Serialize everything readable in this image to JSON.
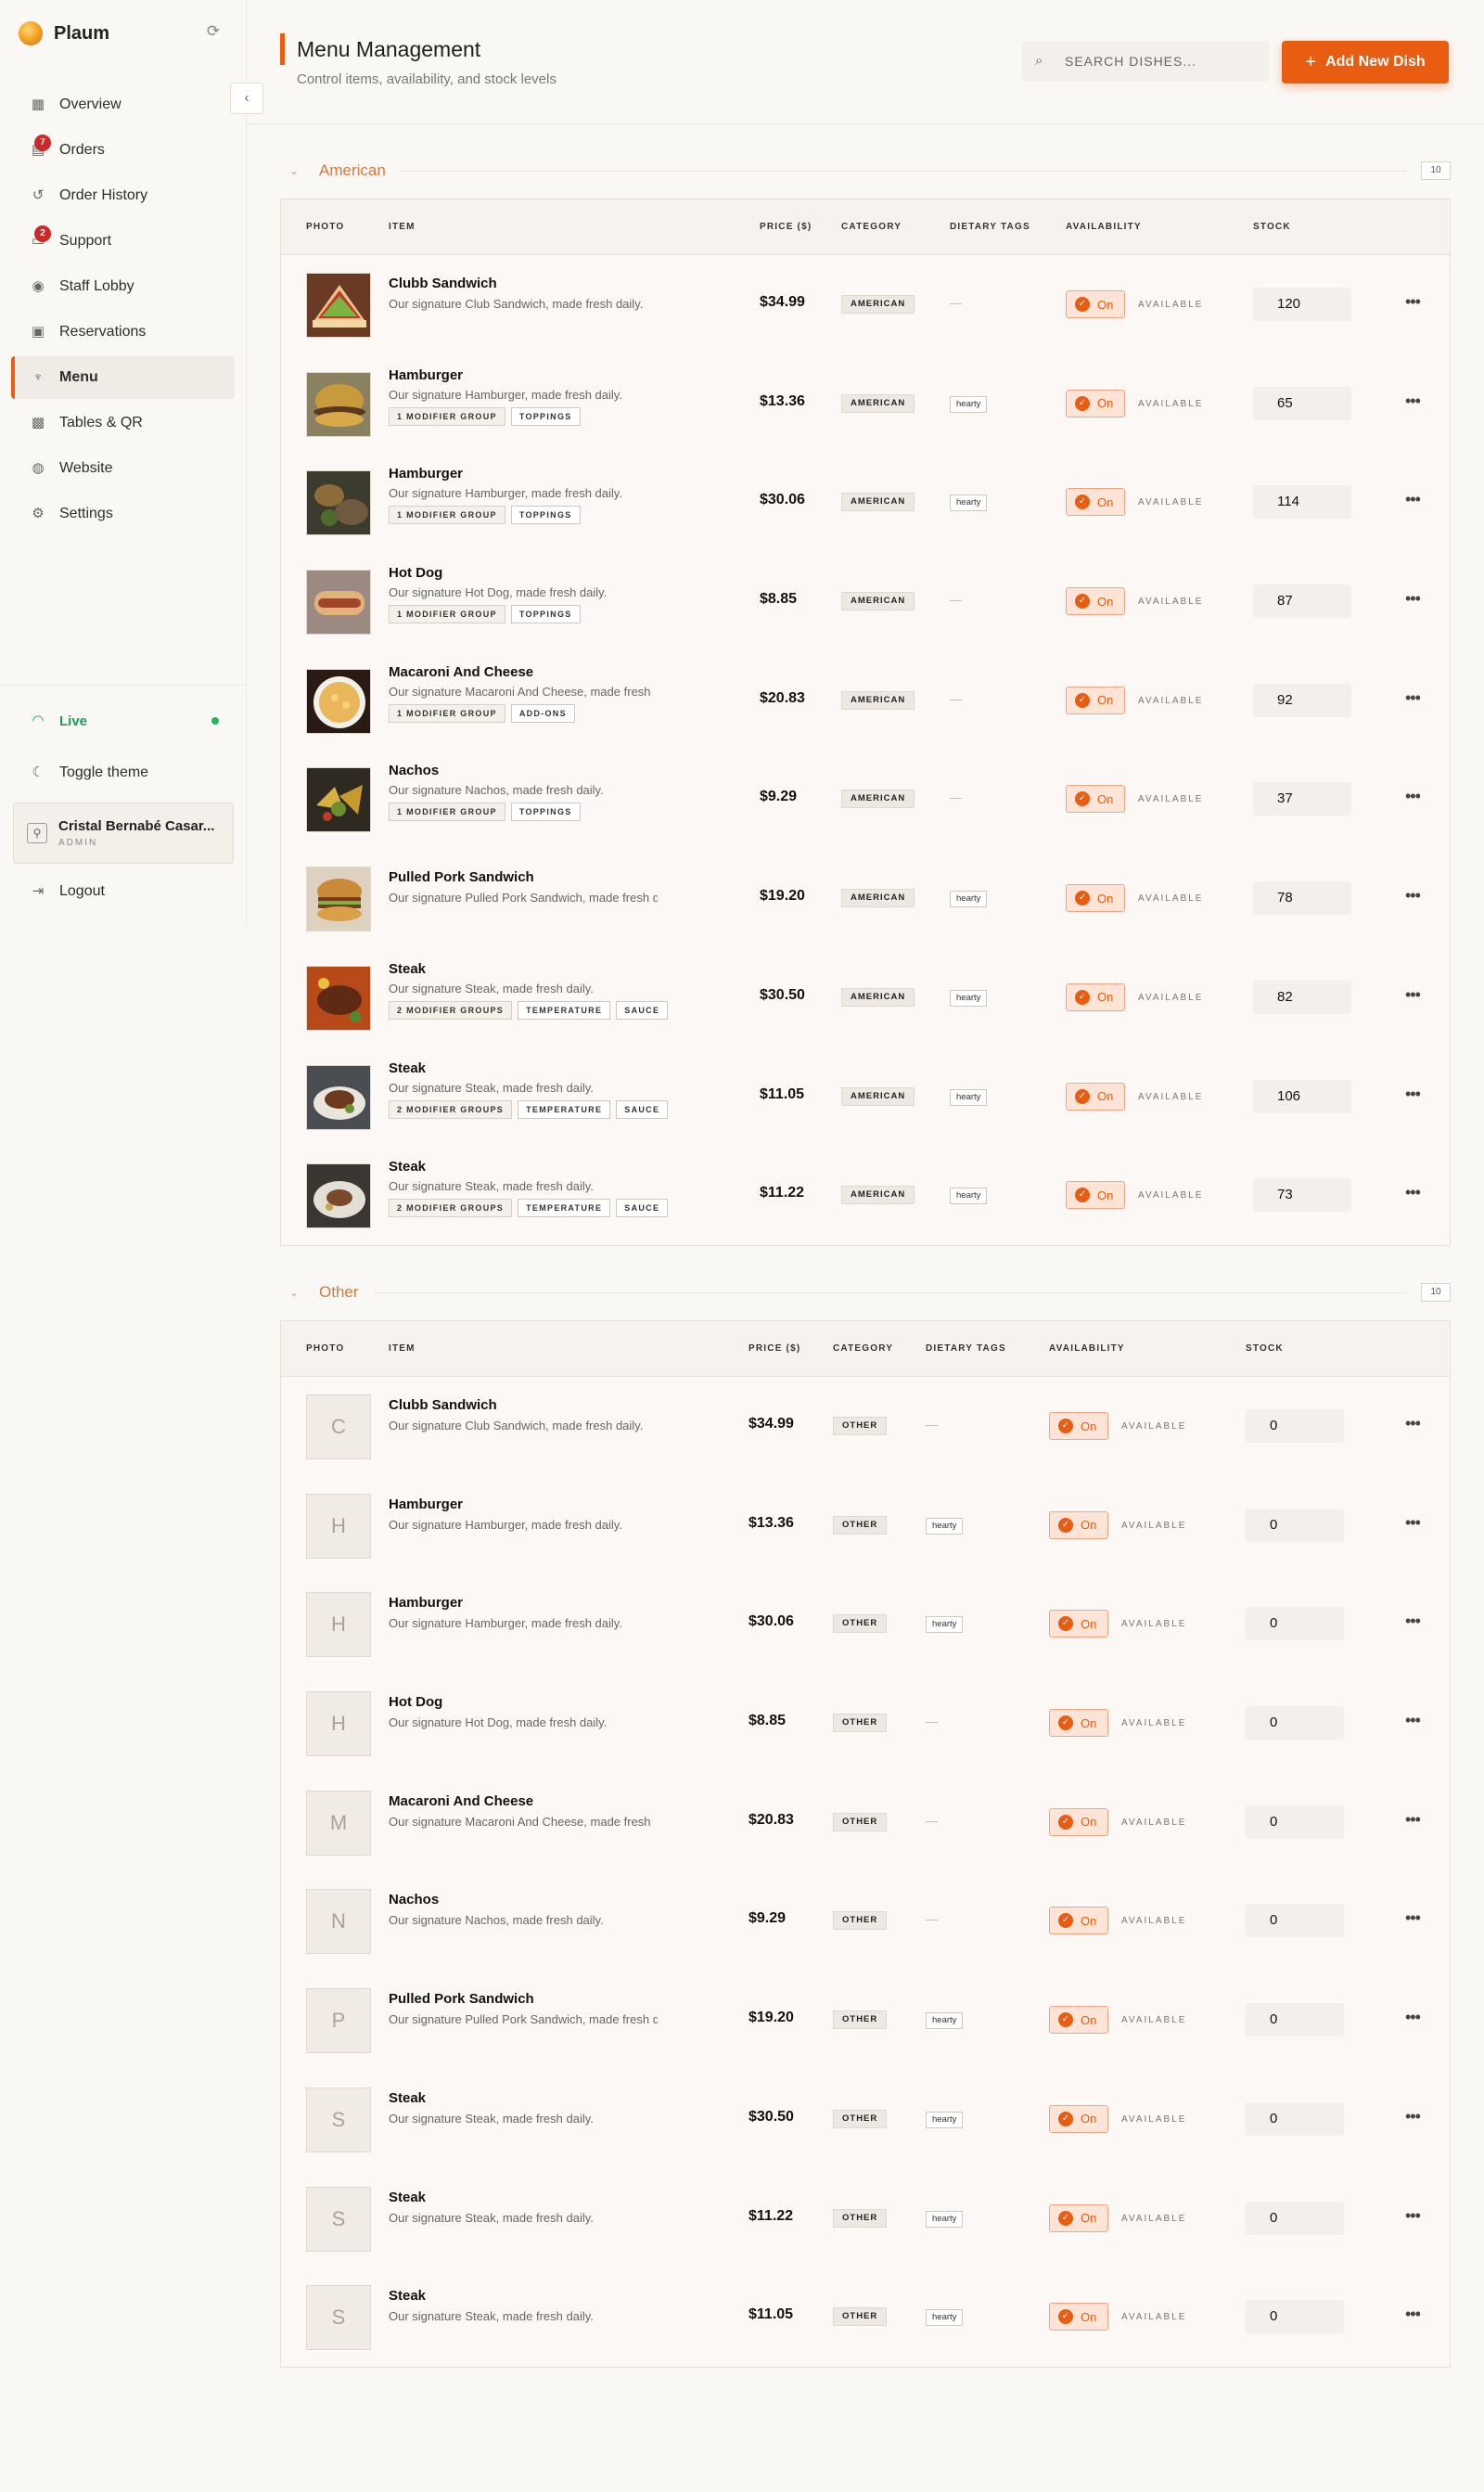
{
  "brand": {
    "name": "Plaum",
    "logo_icon": "logo-icon",
    "refresh_icon": "refresh-icon"
  },
  "nav": [
    {
      "label": "Overview",
      "icon": "grid-icon",
      "glyph": "▦",
      "badge": null,
      "active": false
    },
    {
      "label": "Orders",
      "icon": "receipt-icon",
      "glyph": "▤",
      "badge": "7",
      "active": false
    },
    {
      "label": "Order History",
      "icon": "history-icon",
      "glyph": "↺",
      "badge": null,
      "active": false
    },
    {
      "label": "Support",
      "icon": "chat-icon",
      "glyph": "▭",
      "badge": "2",
      "active": false
    },
    {
      "label": "Staff Lobby",
      "icon": "broadcast-icon",
      "glyph": "◉",
      "badge": null,
      "active": false
    },
    {
      "label": "Reservations",
      "icon": "calendar-icon",
      "glyph": "▣",
      "badge": null,
      "active": false
    },
    {
      "label": "Menu",
      "icon": "utensils-icon",
      "glyph": "♆",
      "badge": null,
      "active": true
    },
    {
      "label": "Tables & QR",
      "icon": "qr-icon",
      "glyph": "▩",
      "badge": null,
      "active": false
    },
    {
      "label": "Website",
      "icon": "globe-icon",
      "glyph": "◍",
      "badge": null,
      "active": false
    },
    {
      "label": "Settings",
      "icon": "gear-icon",
      "glyph": "⚙",
      "badge": null,
      "active": false
    }
  ],
  "sidebar_footer": {
    "live": "Live",
    "toggle_theme": "Toggle theme",
    "user_name": "Cristal Bernabé Casar...",
    "user_role": "ADMIN",
    "logout": "Logout"
  },
  "header": {
    "title": "Menu Management",
    "subtitle": "Control items, availability, and stock levels",
    "search_placeholder": "SEARCH DISHES...",
    "add_button": "Add New Dish"
  },
  "columns": {
    "photo": "PHOTO",
    "item": "ITEM",
    "price": "PRICE ($)",
    "category": "CATEGORY",
    "dietary": "DIETARY TAGS",
    "availability": "AVAILABILITY",
    "stock": "STOCK"
  },
  "colors": {
    "accent": "#e85d12",
    "live": "#22b565",
    "badge": "#c92a2a",
    "section": "#d8783c"
  },
  "sections": [
    {
      "title": "American",
      "count": "10",
      "has_photos": true,
      "items": [
        {
          "name": "Clubb Sandwich",
          "desc": "Our signature Club Sandwich, made fresh daily.",
          "tags": [],
          "price": "$34.99",
          "category": "AMERICAN",
          "diet": "",
          "toggle": "On",
          "availability": "AVAILABLE",
          "stock": "120",
          "initial": "C"
        },
        {
          "name": "Hamburger",
          "desc": "Our signature Hamburger, made fresh daily.",
          "tags": [
            "1 MODIFIER GROUP",
            "TOPPINGS"
          ],
          "price": "$13.36",
          "category": "AMERICAN",
          "diet": "hearty",
          "toggle": "On",
          "availability": "AVAILABLE",
          "stock": "65",
          "initial": "H"
        },
        {
          "name": "Hamburger",
          "desc": "Our signature Hamburger, made fresh daily.",
          "tags": [
            "1 MODIFIER GROUP",
            "TOPPINGS"
          ],
          "price": "$30.06",
          "category": "AMERICAN",
          "diet": "hearty",
          "toggle": "On",
          "availability": "AVAILABLE",
          "stock": "114",
          "initial": "H"
        },
        {
          "name": "Hot Dog",
          "desc": "Our signature Hot Dog, made fresh daily.",
          "tags": [
            "1 MODIFIER GROUP",
            "TOPPINGS"
          ],
          "price": "$8.85",
          "category": "AMERICAN",
          "diet": "",
          "toggle": "On",
          "availability": "AVAILABLE",
          "stock": "87",
          "initial": "H"
        },
        {
          "name": "Macaroni And Cheese",
          "desc": "Our signature Macaroni And Cheese, made fresh",
          "tags": [
            "1 MODIFIER GROUP",
            "ADD-ONS"
          ],
          "price": "$20.83",
          "category": "AMERICAN",
          "diet": "",
          "toggle": "On",
          "availability": "AVAILABLE",
          "stock": "92",
          "initial": "M"
        },
        {
          "name": "Nachos",
          "desc": "Our signature Nachos, made fresh daily.",
          "tags": [
            "1 MODIFIER GROUP",
            "TOPPINGS"
          ],
          "price": "$9.29",
          "category": "AMERICAN",
          "diet": "",
          "toggle": "On",
          "availability": "AVAILABLE",
          "stock": "37",
          "initial": "N"
        },
        {
          "name": "Pulled Pork Sandwich",
          "desc": "Our signature Pulled Pork Sandwich, made fresh d",
          "tags": [],
          "price": "$19.20",
          "category": "AMERICAN",
          "diet": "hearty",
          "toggle": "On",
          "availability": "AVAILABLE",
          "stock": "78",
          "initial": "P"
        },
        {
          "name": "Steak",
          "desc": "Our signature Steak, made fresh daily.",
          "tags": [
            "2 MODIFIER GROUPS",
            "TEMPERATURE",
            "SAUCE"
          ],
          "price": "$30.50",
          "category": "AMERICAN",
          "diet": "hearty",
          "toggle": "On",
          "availability": "AVAILABLE",
          "stock": "82",
          "initial": "S"
        },
        {
          "name": "Steak",
          "desc": "Our signature Steak, made fresh daily.",
          "tags": [
            "2 MODIFIER GROUPS",
            "TEMPERATURE",
            "SAUCE"
          ],
          "price": "$11.05",
          "category": "AMERICAN",
          "diet": "hearty",
          "toggle": "On",
          "availability": "AVAILABLE",
          "stock": "106",
          "initial": "S"
        },
        {
          "name": "Steak",
          "desc": "Our signature Steak, made fresh daily.",
          "tags": [
            "2 MODIFIER GROUPS",
            "TEMPERATURE",
            "SAUCE"
          ],
          "price": "$11.22",
          "category": "AMERICAN",
          "diet": "hearty",
          "toggle": "On",
          "availability": "AVAILABLE",
          "stock": "73",
          "initial": "S"
        }
      ]
    },
    {
      "title": "Other",
      "count": "10",
      "has_photos": false,
      "items": [
        {
          "name": "Clubb Sandwich",
          "desc": "Our signature Club Sandwich, made fresh daily.",
          "tags": [],
          "price": "$34.99",
          "category": "OTHER",
          "diet": "",
          "toggle": "On",
          "availability": "AVAILABLE",
          "stock": "0",
          "initial": "C"
        },
        {
          "name": "Hamburger",
          "desc": "Our signature Hamburger, made fresh daily.",
          "tags": [],
          "price": "$13.36",
          "category": "OTHER",
          "diet": "hearty",
          "toggle": "On",
          "availability": "AVAILABLE",
          "stock": "0",
          "initial": "H"
        },
        {
          "name": "Hamburger",
          "desc": "Our signature Hamburger, made fresh daily.",
          "tags": [],
          "price": "$30.06",
          "category": "OTHER",
          "diet": "hearty",
          "toggle": "On",
          "availability": "AVAILABLE",
          "stock": "0",
          "initial": "H"
        },
        {
          "name": "Hot Dog",
          "desc": "Our signature Hot Dog, made fresh daily.",
          "tags": [],
          "price": "$8.85",
          "category": "OTHER",
          "diet": "",
          "toggle": "On",
          "availability": "AVAILABLE",
          "stock": "0",
          "initial": "H"
        },
        {
          "name": "Macaroni And Cheese",
          "desc": "Our signature Macaroni And Cheese, made fresh",
          "tags": [],
          "price": "$20.83",
          "category": "OTHER",
          "diet": "",
          "toggle": "On",
          "availability": "AVAILABLE",
          "stock": "0",
          "initial": "M"
        },
        {
          "name": "Nachos",
          "desc": "Our signature Nachos, made fresh daily.",
          "tags": [],
          "price": "$9.29",
          "category": "OTHER",
          "diet": "",
          "toggle": "On",
          "availability": "AVAILABLE",
          "stock": "0",
          "initial": "N"
        },
        {
          "name": "Pulled Pork Sandwich",
          "desc": "Our signature Pulled Pork Sandwich, made fresh d",
          "tags": [],
          "price": "$19.20",
          "category": "OTHER",
          "diet": "hearty",
          "toggle": "On",
          "availability": "AVAILABLE",
          "stock": "0",
          "initial": "P"
        },
        {
          "name": "Steak",
          "desc": "Our signature Steak, made fresh daily.",
          "tags": [],
          "price": "$30.50",
          "category": "OTHER",
          "diet": "hearty",
          "toggle": "On",
          "availability": "AVAILABLE",
          "stock": "0",
          "initial": "S"
        },
        {
          "name": "Steak",
          "desc": "Our signature Steak, made fresh daily.",
          "tags": [],
          "price": "$11.22",
          "category": "OTHER",
          "diet": "hearty",
          "toggle": "On",
          "availability": "AVAILABLE",
          "stock": "0",
          "initial": "S"
        },
        {
          "name": "Steak",
          "desc": "Our signature Steak, made fresh daily.",
          "tags": [],
          "price": "$11.05",
          "category": "OTHER",
          "diet": "hearty",
          "toggle": "On",
          "availability": "AVAILABLE",
          "stock": "0",
          "initial": "S"
        }
      ]
    }
  ]
}
